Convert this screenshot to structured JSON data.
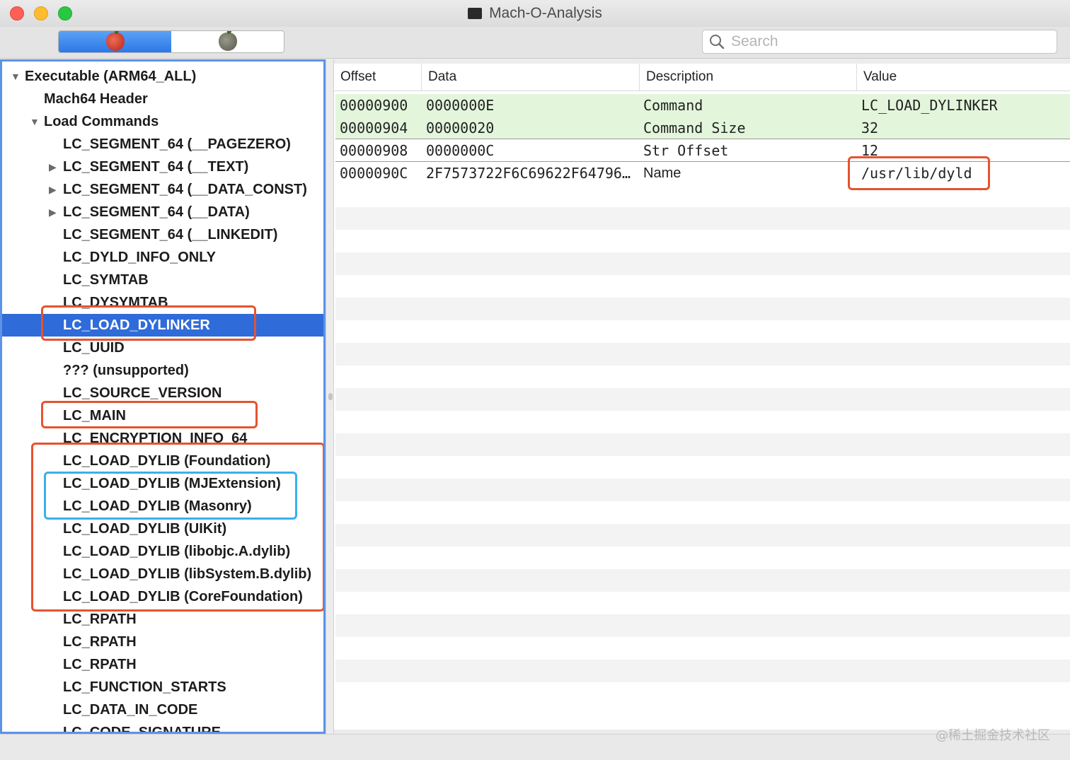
{
  "window": {
    "title": "Mach-O-Analysis"
  },
  "toolbar": {
    "segments": [
      {
        "icon": "red-apple-icon",
        "active": true
      },
      {
        "icon": "gray-apple-icon",
        "active": false
      }
    ],
    "search_placeholder": "Search"
  },
  "sidebar": {
    "items": [
      {
        "label": "Executable  (ARM64_ALL)",
        "level": 0,
        "disclosure": "expanded"
      },
      {
        "label": "Mach64 Header",
        "level": 1,
        "disclosure": "none"
      },
      {
        "label": "Load Commands",
        "level": 1,
        "disclosure": "expanded"
      },
      {
        "label": "LC_SEGMENT_64 (__PAGEZERO)",
        "level": 2,
        "disclosure": "none"
      },
      {
        "label": "LC_SEGMENT_64 (__TEXT)",
        "level": 2,
        "disclosure": "collapsed"
      },
      {
        "label": "LC_SEGMENT_64 (__DATA_CONST)",
        "level": 2,
        "disclosure": "collapsed"
      },
      {
        "label": "LC_SEGMENT_64 (__DATA)",
        "level": 2,
        "disclosure": "collapsed"
      },
      {
        "label": "LC_SEGMENT_64 (__LINKEDIT)",
        "level": 2,
        "disclosure": "none"
      },
      {
        "label": "LC_DYLD_INFO_ONLY",
        "level": 2,
        "disclosure": "none"
      },
      {
        "label": "LC_SYMTAB",
        "level": 2,
        "disclosure": "none"
      },
      {
        "label": "LC_DYSYMTAB",
        "level": 2,
        "disclosure": "none"
      },
      {
        "label": "LC_LOAD_DYLINKER",
        "level": 2,
        "disclosure": "none",
        "selected": true
      },
      {
        "label": "LC_UUID",
        "level": 2,
        "disclosure": "none"
      },
      {
        "label": "??? (unsupported)",
        "level": 2,
        "disclosure": "none"
      },
      {
        "label": "LC_SOURCE_VERSION",
        "level": 2,
        "disclosure": "none"
      },
      {
        "label": "LC_MAIN",
        "level": 2,
        "disclosure": "none"
      },
      {
        "label": "LC_ENCRYPTION_INFO_64",
        "level": 2,
        "disclosure": "none"
      },
      {
        "label": "LC_LOAD_DYLIB (Foundation)",
        "level": 2,
        "disclosure": "none"
      },
      {
        "label": "LC_LOAD_DYLIB (MJExtension)",
        "level": 2,
        "disclosure": "none"
      },
      {
        "label": "LC_LOAD_DYLIB (Masonry)",
        "level": 2,
        "disclosure": "none"
      },
      {
        "label": "LC_LOAD_DYLIB (UIKit)",
        "level": 2,
        "disclosure": "none"
      },
      {
        "label": "LC_LOAD_DYLIB (libobjc.A.dylib)",
        "level": 2,
        "disclosure": "none"
      },
      {
        "label": "LC_LOAD_DYLIB (libSystem.B.dylib)",
        "level": 2,
        "disclosure": "none"
      },
      {
        "label": "LC_LOAD_DYLIB (CoreFoundation)",
        "level": 2,
        "disclosure": "none"
      },
      {
        "label": "LC_RPATH",
        "level": 2,
        "disclosure": "none"
      },
      {
        "label": "LC_RPATH",
        "level": 2,
        "disclosure": "none"
      },
      {
        "label": "LC_RPATH",
        "level": 2,
        "disclosure": "none"
      },
      {
        "label": "LC_FUNCTION_STARTS",
        "level": 2,
        "disclosure": "none"
      },
      {
        "label": "LC_DATA_IN_CODE",
        "level": 2,
        "disclosure": "none"
      },
      {
        "label": "LC_CODE_SIGNATURE",
        "level": 2,
        "disclosure": "none"
      }
    ]
  },
  "table": {
    "columns": [
      "Offset",
      "Data",
      "Description",
      "Value"
    ],
    "rows": [
      {
        "offset": "00000900",
        "data": "0000000E",
        "description": "Command",
        "value": "LC_LOAD_DYLINKER",
        "tint": "green"
      },
      {
        "offset": "00000904",
        "data": "00000020",
        "description": "Command Size",
        "value": "32",
        "tint": "green"
      },
      {
        "offset": "00000908",
        "data": "0000000C",
        "description": "Str Offset",
        "value": "12",
        "tint": "none"
      },
      {
        "offset": "0000090C",
        "data": "2F7573722F6C69622F64796…",
        "description": "Name",
        "value": "/usr/lib/dyld",
        "tint": "none"
      }
    ]
  },
  "colors": {
    "selection": "#2f6bd9",
    "green_row": "#e3f6dc",
    "annotation_red": "#e5532e",
    "annotation_blue": "#3ab0e8"
  },
  "watermark": "@稀土掘金技术社区"
}
